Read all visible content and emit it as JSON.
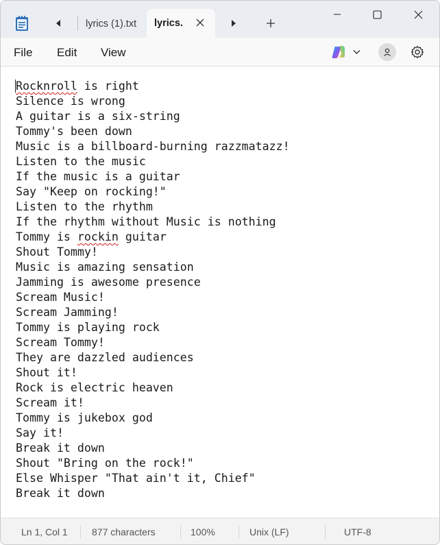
{
  "tabs": [
    {
      "label": "lyrics (1).txt",
      "active": false
    },
    {
      "label": "lyrics.",
      "active": true
    }
  ],
  "menu": {
    "file": "File",
    "edit": "Edit",
    "view": "View"
  },
  "icons": {
    "app": "notepad-icon",
    "back": "chevron-left-icon",
    "forward": "chevron-right-icon",
    "new_tab": "plus-icon",
    "copilot": "copilot-icon",
    "account": "account-icon",
    "settings": "gear-icon"
  },
  "editor": {
    "lines": [
      "Rocknroll is right",
      "Silence is wrong",
      "A guitar is a six-string",
      "Tommy's been down",
      "Music is a billboard-burning razzmatazz!",
      "Listen to the music",
      "If the music is a guitar",
      "Say \"Keep on rocking!\"",
      "Listen to the rhythm",
      "If the rhythm without Music is nothing",
      "Tommy is rockin guitar",
      "Shout Tommy!",
      "Music is amazing sensation",
      "Jamming is awesome presence",
      "Scream Music!",
      "Scream Jamming!",
      "Tommy is playing rock",
      "Scream Tommy!",
      "They are dazzled audiences",
      "Shout it!",
      "Rock is electric heaven",
      "Scream it!",
      "Tommy is jukebox god",
      "Say it!",
      "Break it down",
      "Shout \"Bring on the rock!\"",
      "Else Whisper \"That ain't it, Chief\"",
      "Break it down"
    ],
    "misspelled_words": [
      "Rocknroll",
      "rockin"
    ]
  },
  "status": {
    "position": "Ln 1, Col 1",
    "characters": "877 characters",
    "zoom": "100%",
    "line_ending": "Unix (LF)",
    "encoding": "UTF-8"
  },
  "colors": {
    "titlebar": "#eaeef2",
    "active_tab": "#f9f9f9",
    "spellcheck": "#d11a1a"
  }
}
